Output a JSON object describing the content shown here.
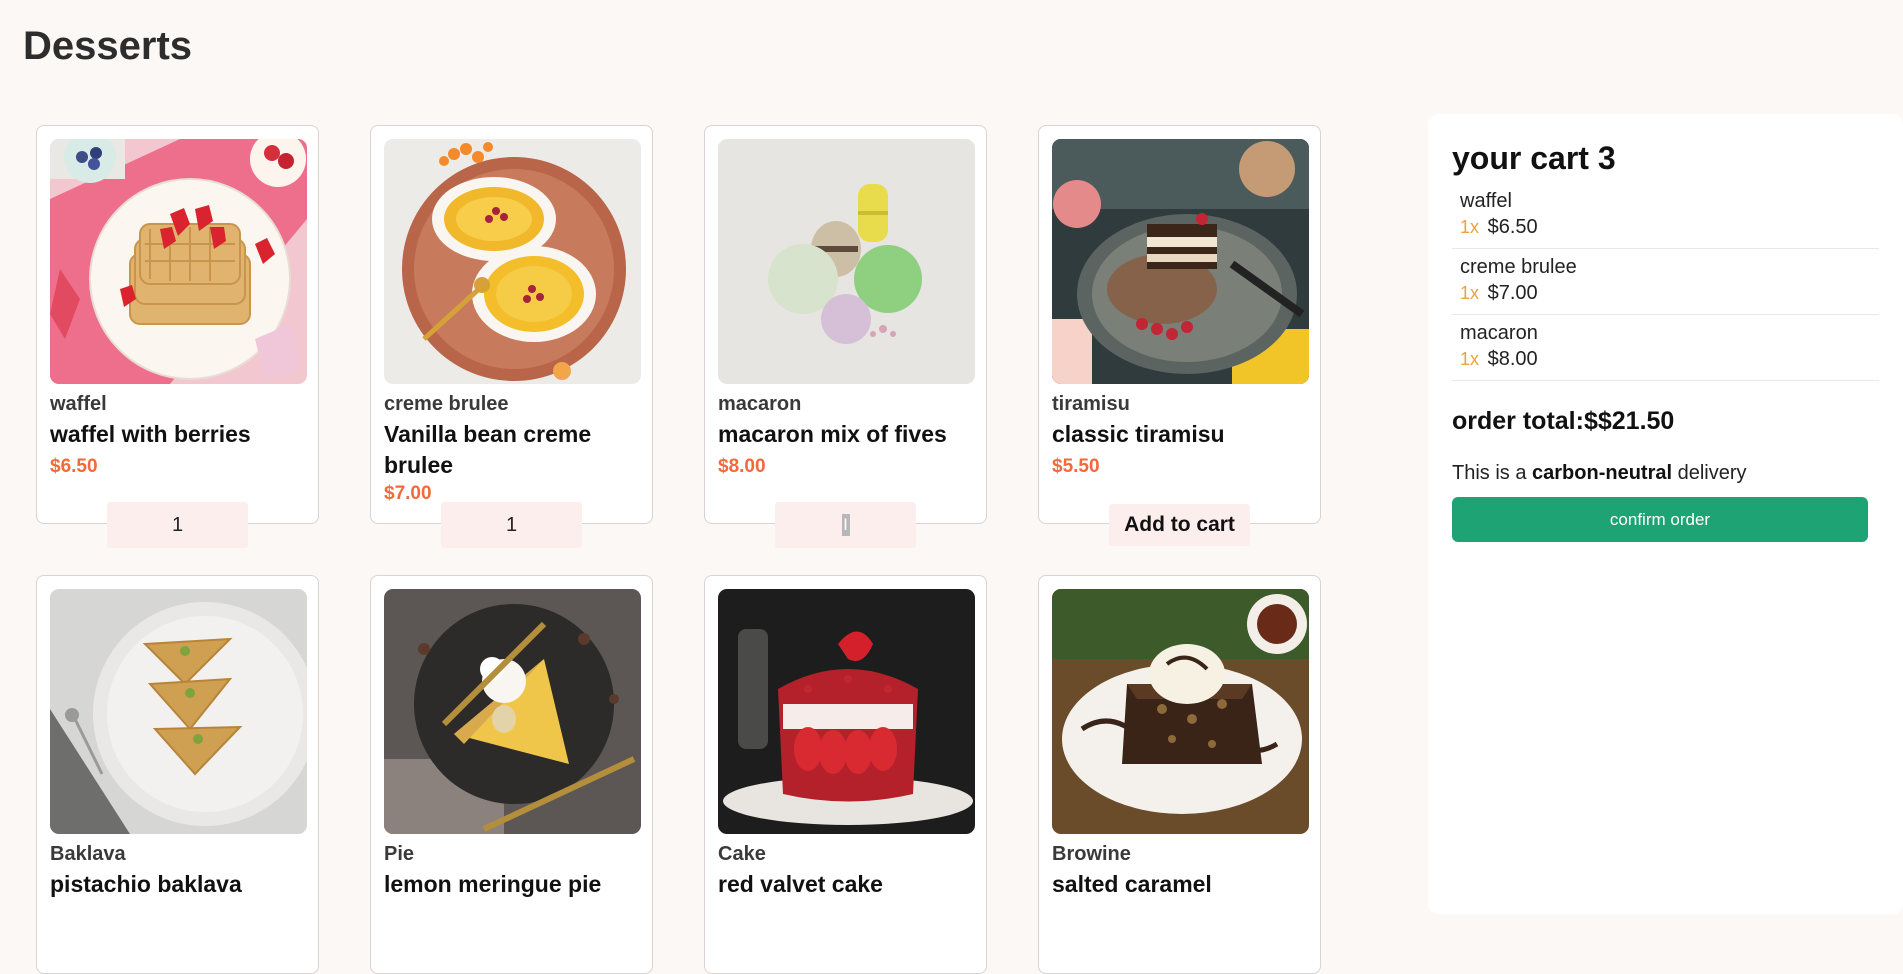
{
  "page": {
    "title": "Desserts"
  },
  "products": [
    {
      "category": "waffel",
      "name": "waffel with berries",
      "price": "$6.50",
      "button": "1"
    },
    {
      "category": "creme brulee",
      "name": "Vanilla bean creme brulee",
      "price": "$7.00",
      "button": "1"
    },
    {
      "category": "macaron",
      "name": "macaron mix of fives",
      "price": "$8.00",
      "button": "I"
    },
    {
      "category": "tiramisu",
      "name": "classic tiramisu",
      "price": "$5.50",
      "button": "Add to cart"
    },
    {
      "category": "Baklava",
      "name": "pistachio baklava",
      "price": "",
      "button": ""
    },
    {
      "category": "Pie",
      "name": "lemon meringue pie",
      "price": "",
      "button": ""
    },
    {
      "category": "Cake",
      "name": "red valvet cake",
      "price": "",
      "button": ""
    },
    {
      "category": "Browine",
      "name": "salted caramel",
      "price": "",
      "button": ""
    }
  ],
  "cart": {
    "title": "your cart 3",
    "items": [
      {
        "name": "waffel",
        "qty": "1x",
        "price": "$6.50"
      },
      {
        "name": "creme brulee",
        "qty": "1x",
        "price": "$7.00"
      },
      {
        "name": "macaron",
        "qty": "1x",
        "price": "$8.00"
      }
    ],
    "total_label": "order total:$",
    "total_value": "$21.50",
    "carbon_prefix": "This is a ",
    "carbon_bold": "carbon-neutral",
    "carbon_suffix": " delivery",
    "confirm_label": "confirm order"
  },
  "colors": {
    "background": "#fcf8f5",
    "price": "#f26a3a",
    "qty_accent": "#e8a33a",
    "confirm": "#1ea474",
    "button_bg": "#fdeeee"
  }
}
